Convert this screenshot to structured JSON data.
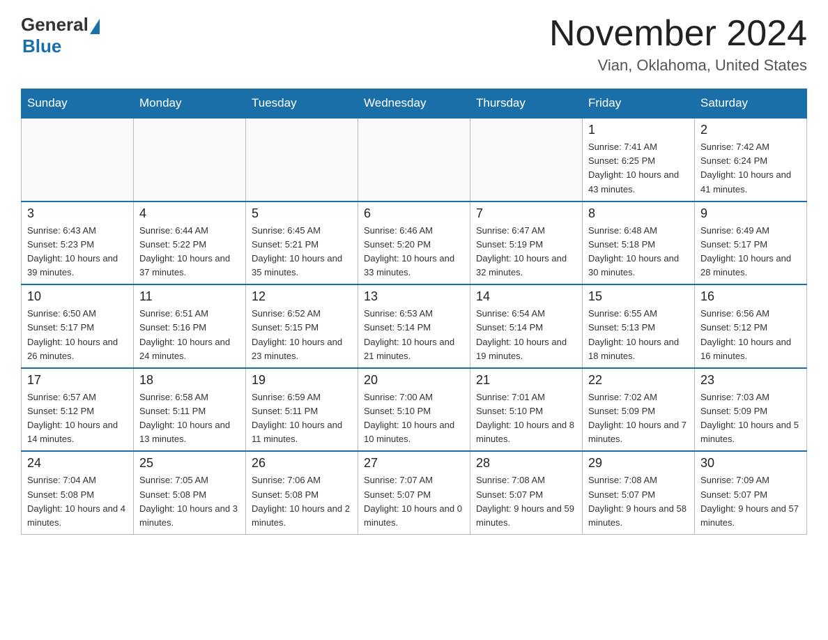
{
  "header": {
    "logo_general": "General",
    "logo_blue": "Blue",
    "title": "November 2024",
    "location": "Vian, Oklahoma, United States"
  },
  "days_of_week": [
    "Sunday",
    "Monday",
    "Tuesday",
    "Wednesday",
    "Thursday",
    "Friday",
    "Saturday"
  ],
  "weeks": [
    [
      {
        "day": "",
        "sunrise": "",
        "sunset": "",
        "daylight": ""
      },
      {
        "day": "",
        "sunrise": "",
        "sunset": "",
        "daylight": ""
      },
      {
        "day": "",
        "sunrise": "",
        "sunset": "",
        "daylight": ""
      },
      {
        "day": "",
        "sunrise": "",
        "sunset": "",
        "daylight": ""
      },
      {
        "day": "",
        "sunrise": "",
        "sunset": "",
        "daylight": ""
      },
      {
        "day": "1",
        "sunrise": "Sunrise: 7:41 AM",
        "sunset": "Sunset: 6:25 PM",
        "daylight": "Daylight: 10 hours and 43 minutes."
      },
      {
        "day": "2",
        "sunrise": "Sunrise: 7:42 AM",
        "sunset": "Sunset: 6:24 PM",
        "daylight": "Daylight: 10 hours and 41 minutes."
      }
    ],
    [
      {
        "day": "3",
        "sunrise": "Sunrise: 6:43 AM",
        "sunset": "Sunset: 5:23 PM",
        "daylight": "Daylight: 10 hours and 39 minutes."
      },
      {
        "day": "4",
        "sunrise": "Sunrise: 6:44 AM",
        "sunset": "Sunset: 5:22 PM",
        "daylight": "Daylight: 10 hours and 37 minutes."
      },
      {
        "day": "5",
        "sunrise": "Sunrise: 6:45 AM",
        "sunset": "Sunset: 5:21 PM",
        "daylight": "Daylight: 10 hours and 35 minutes."
      },
      {
        "day": "6",
        "sunrise": "Sunrise: 6:46 AM",
        "sunset": "Sunset: 5:20 PM",
        "daylight": "Daylight: 10 hours and 33 minutes."
      },
      {
        "day": "7",
        "sunrise": "Sunrise: 6:47 AM",
        "sunset": "Sunset: 5:19 PM",
        "daylight": "Daylight: 10 hours and 32 minutes."
      },
      {
        "day": "8",
        "sunrise": "Sunrise: 6:48 AM",
        "sunset": "Sunset: 5:18 PM",
        "daylight": "Daylight: 10 hours and 30 minutes."
      },
      {
        "day": "9",
        "sunrise": "Sunrise: 6:49 AM",
        "sunset": "Sunset: 5:17 PM",
        "daylight": "Daylight: 10 hours and 28 minutes."
      }
    ],
    [
      {
        "day": "10",
        "sunrise": "Sunrise: 6:50 AM",
        "sunset": "Sunset: 5:17 PM",
        "daylight": "Daylight: 10 hours and 26 minutes."
      },
      {
        "day": "11",
        "sunrise": "Sunrise: 6:51 AM",
        "sunset": "Sunset: 5:16 PM",
        "daylight": "Daylight: 10 hours and 24 minutes."
      },
      {
        "day": "12",
        "sunrise": "Sunrise: 6:52 AM",
        "sunset": "Sunset: 5:15 PM",
        "daylight": "Daylight: 10 hours and 23 minutes."
      },
      {
        "day": "13",
        "sunrise": "Sunrise: 6:53 AM",
        "sunset": "Sunset: 5:14 PM",
        "daylight": "Daylight: 10 hours and 21 minutes."
      },
      {
        "day": "14",
        "sunrise": "Sunrise: 6:54 AM",
        "sunset": "Sunset: 5:14 PM",
        "daylight": "Daylight: 10 hours and 19 minutes."
      },
      {
        "day": "15",
        "sunrise": "Sunrise: 6:55 AM",
        "sunset": "Sunset: 5:13 PM",
        "daylight": "Daylight: 10 hours and 18 minutes."
      },
      {
        "day": "16",
        "sunrise": "Sunrise: 6:56 AM",
        "sunset": "Sunset: 5:12 PM",
        "daylight": "Daylight: 10 hours and 16 minutes."
      }
    ],
    [
      {
        "day": "17",
        "sunrise": "Sunrise: 6:57 AM",
        "sunset": "Sunset: 5:12 PM",
        "daylight": "Daylight: 10 hours and 14 minutes."
      },
      {
        "day": "18",
        "sunrise": "Sunrise: 6:58 AM",
        "sunset": "Sunset: 5:11 PM",
        "daylight": "Daylight: 10 hours and 13 minutes."
      },
      {
        "day": "19",
        "sunrise": "Sunrise: 6:59 AM",
        "sunset": "Sunset: 5:11 PM",
        "daylight": "Daylight: 10 hours and 11 minutes."
      },
      {
        "day": "20",
        "sunrise": "Sunrise: 7:00 AM",
        "sunset": "Sunset: 5:10 PM",
        "daylight": "Daylight: 10 hours and 10 minutes."
      },
      {
        "day": "21",
        "sunrise": "Sunrise: 7:01 AM",
        "sunset": "Sunset: 5:10 PM",
        "daylight": "Daylight: 10 hours and 8 minutes."
      },
      {
        "day": "22",
        "sunrise": "Sunrise: 7:02 AM",
        "sunset": "Sunset: 5:09 PM",
        "daylight": "Daylight: 10 hours and 7 minutes."
      },
      {
        "day": "23",
        "sunrise": "Sunrise: 7:03 AM",
        "sunset": "Sunset: 5:09 PM",
        "daylight": "Daylight: 10 hours and 5 minutes."
      }
    ],
    [
      {
        "day": "24",
        "sunrise": "Sunrise: 7:04 AM",
        "sunset": "Sunset: 5:08 PM",
        "daylight": "Daylight: 10 hours and 4 minutes."
      },
      {
        "day": "25",
        "sunrise": "Sunrise: 7:05 AM",
        "sunset": "Sunset: 5:08 PM",
        "daylight": "Daylight: 10 hours and 3 minutes."
      },
      {
        "day": "26",
        "sunrise": "Sunrise: 7:06 AM",
        "sunset": "Sunset: 5:08 PM",
        "daylight": "Daylight: 10 hours and 2 minutes."
      },
      {
        "day": "27",
        "sunrise": "Sunrise: 7:07 AM",
        "sunset": "Sunset: 5:07 PM",
        "daylight": "Daylight: 10 hours and 0 minutes."
      },
      {
        "day": "28",
        "sunrise": "Sunrise: 7:08 AM",
        "sunset": "Sunset: 5:07 PM",
        "daylight": "Daylight: 9 hours and 59 minutes."
      },
      {
        "day": "29",
        "sunrise": "Sunrise: 7:08 AM",
        "sunset": "Sunset: 5:07 PM",
        "daylight": "Daylight: 9 hours and 58 minutes."
      },
      {
        "day": "30",
        "sunrise": "Sunrise: 7:09 AM",
        "sunset": "Sunset: 5:07 PM",
        "daylight": "Daylight: 9 hours and 57 minutes."
      }
    ]
  ]
}
